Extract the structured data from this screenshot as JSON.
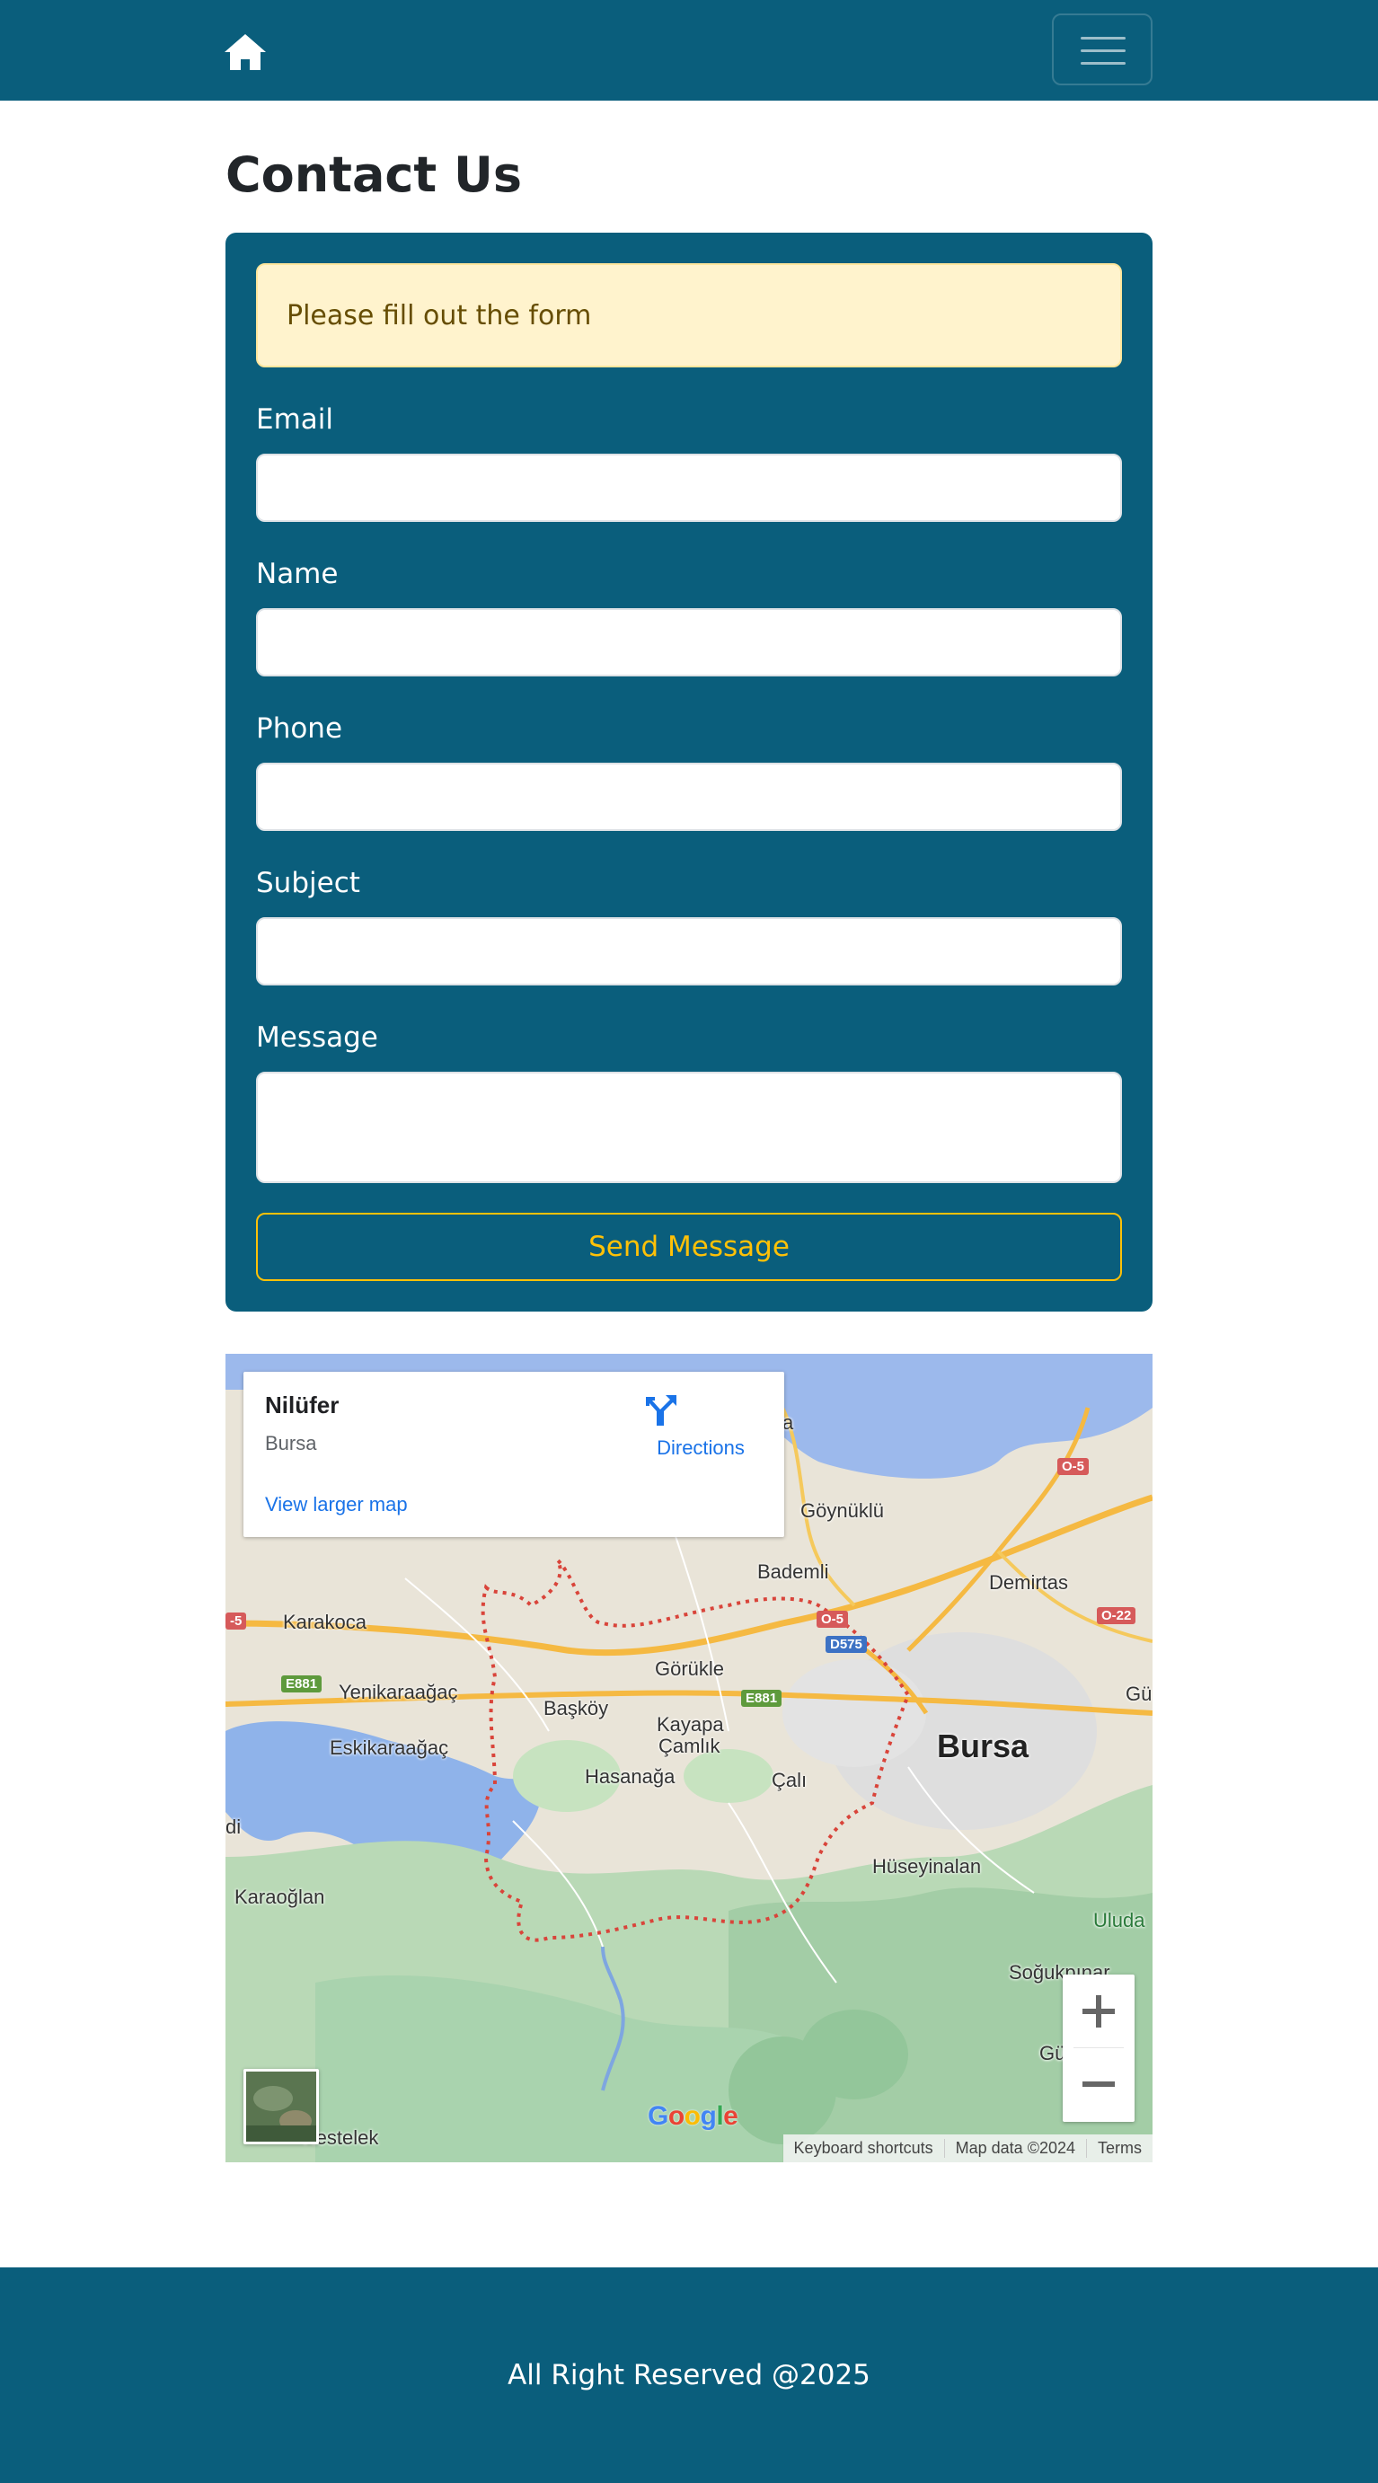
{
  "colors": {
    "brand": "#0a5e7c",
    "warning_bg": "#fff3cd",
    "warning_text": "#664d03",
    "accent": "#ffc107",
    "link": "#1a73e8"
  },
  "navbar": {
    "home_icon": "home-icon",
    "menu_icon": "hamburger-menu-icon"
  },
  "page": {
    "title": "Contact Us"
  },
  "form": {
    "alert": "Please fill out the form",
    "fields": [
      {
        "label": "Email",
        "value": ""
      },
      {
        "label": "Name",
        "value": ""
      },
      {
        "label": "Phone",
        "value": ""
      },
      {
        "label": "Subject",
        "value": ""
      },
      {
        "label": "Message",
        "value": ""
      }
    ],
    "submit_label": "Send Message"
  },
  "map": {
    "place": {
      "name": "Nilüfer",
      "region": "Bursa",
      "directions_label": "Directions",
      "larger_map_label": "View larger map"
    },
    "labels": {
      "goynuklu": "Göynüklü",
      "bademli": "Bademli",
      "demirtas": "Demirtas",
      "karakoca": "Karakoca",
      "gorukle": "Görükle",
      "yenikaraagac": "Yenikaraağaç",
      "baskoy": "Başköy",
      "kayapa": "Kayapa",
      "camlik": "Çamlık",
      "eskikaraagac": "Eskikaraağaç",
      "bursa": "Bursa",
      "hasanaga": "Hasanağa",
      "cali": "Çalı",
      "hüseyinalan": "Hüseyinalan",
      "karaoglan": "Karaoğlan",
      "uluda": "Uluda",
      "sogukpinar": "Soğukpınar",
      "kestelek": "Kestelek",
      "gu_east": "Gü",
      "gu_south": "Gü",
      "di": "di",
      "a_north": "a"
    },
    "road_badges": {
      "o5_ne": "O-5",
      "o5_west": "-5",
      "o22": "O-22",
      "o5_center": "O-5",
      "d575": "D575",
      "e881_west": "E881",
      "e881_center": "E881"
    },
    "google_logo": [
      "G",
      "o",
      "o",
      "g",
      "l",
      "e"
    ],
    "google_colors": [
      "#4285F4",
      "#EA4335",
      "#FBBC05",
      "#4285F4",
      "#34A853",
      "#EA4335"
    ],
    "attribution": {
      "keyboard_shortcuts": "Keyboard shortcuts",
      "map_data": "Map data ©2024",
      "terms": "Terms"
    }
  },
  "footer": {
    "text": "All Right Reserved @2025"
  }
}
